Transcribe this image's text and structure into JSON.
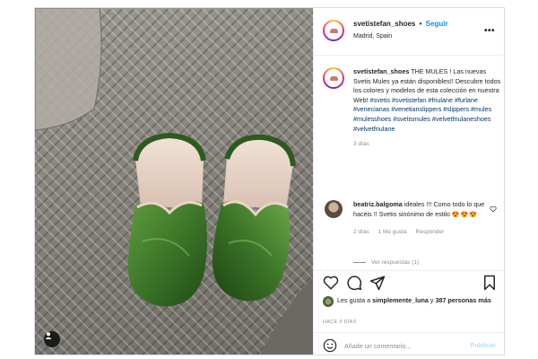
{
  "post": {
    "username": "svetistefan_shoes",
    "separator": "•",
    "follow_label": "Seguir",
    "location": "Madrid, Spain",
    "more_icon": "more-horizontal-icon"
  },
  "caption": {
    "username": "svetistefan_shoes",
    "text": "THE MULES ! Las nuevas Svetis Mules ya están disponibles!! Descubre todos los colores y modelos de esta colección en nuestra Web!",
    "hashtags": "#svetis #svetistefan #friulane #furlane #venecianas #venetianslippers #slippers #mules #mulesshoes #svetismules #velvetfriulaneshoes #velvetfriulane",
    "time": "3 días"
  },
  "comment": {
    "username": "beatriz.balgoma",
    "text": "ideales !!! Como todo lo que hacéis !! Svetis sinónimo de estilo",
    "emojis": "😍😍😍",
    "time": "2 días",
    "likes": "1 Me gusta",
    "reply_label": "Responder"
  },
  "replies_label": "Ver respuestas (1)",
  "likes": {
    "prefix": "Les gusta a",
    "user": "simplemente_luna",
    "connector": "y",
    "others": "387 personas más"
  },
  "posted": "HACE 3 DÍAS",
  "add_comment": {
    "placeholder": "Añade un comentario...",
    "publish_label": "Publicar"
  },
  "colors": {
    "link": "#0095f6",
    "hashtag": "#00376b",
    "publish_disabled": "#b2dffc",
    "velvet_green": "#3f7a2a"
  }
}
